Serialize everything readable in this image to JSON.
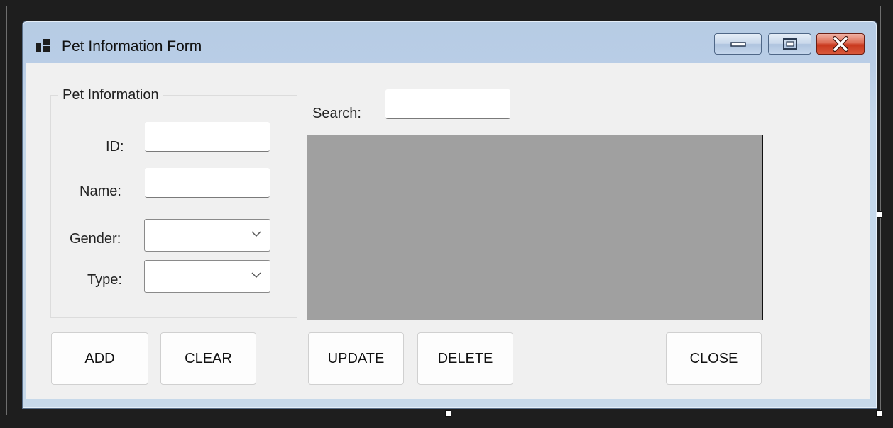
{
  "window": {
    "title": "Pet Information Form",
    "icon": "app-form-icon"
  },
  "caption_buttons": {
    "minimize_icon": "minimize-icon",
    "maximize_icon": "maximize-icon",
    "close_icon": "close-x-icon"
  },
  "group": {
    "title": "Pet Information"
  },
  "fields": {
    "id_label": "ID:",
    "id_value": "",
    "name_label": "Name:",
    "name_value": "",
    "gender_label": "Gender:",
    "gender_value": "",
    "type_label": "Type:",
    "type_value": ""
  },
  "search": {
    "label": "Search:",
    "value": ""
  },
  "buttons": {
    "add": "ADD",
    "clear": "CLEAR",
    "update": "UPDATE",
    "delete": "DELETE",
    "close": "CLOSE"
  },
  "colors": {
    "grid_background": "#a0a0a0",
    "client_background": "#f0f0f0",
    "close_button": "#c8381e"
  }
}
